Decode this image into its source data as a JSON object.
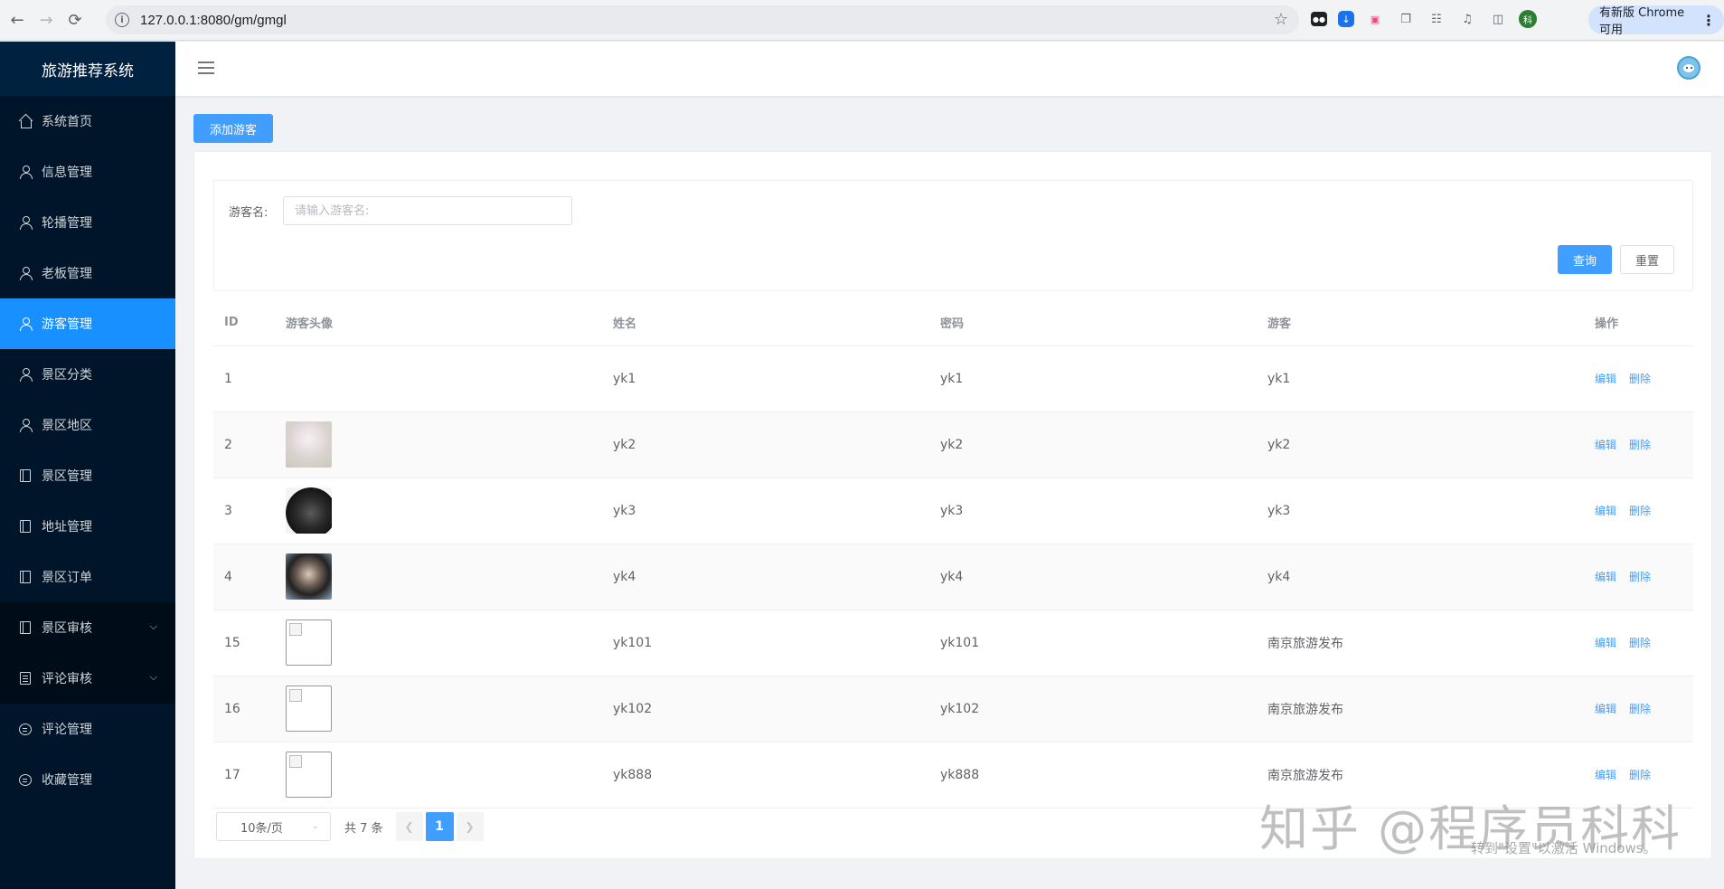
{
  "browser": {
    "url": "127.0.0.1:8080/gm/gmgl",
    "update_badge": "有新版 Chrome 可用",
    "profile_initial": "科"
  },
  "app": {
    "brand": "旅游推荐系统"
  },
  "sidebar": {
    "items": [
      {
        "label": "系统首页",
        "icon": "house-icon"
      },
      {
        "label": "信息管理",
        "icon": "user-icon"
      },
      {
        "label": "轮播管理",
        "icon": "user-icon"
      },
      {
        "label": "老板管理",
        "icon": "user-icon"
      },
      {
        "label": "游客管理",
        "icon": "user-icon",
        "active": true
      },
      {
        "label": "景区分类",
        "icon": "user-icon"
      },
      {
        "label": "景区地区",
        "icon": "user-icon"
      },
      {
        "label": "景区管理",
        "icon": "book-icon"
      },
      {
        "label": "地址管理",
        "icon": "book-icon"
      },
      {
        "label": "景区订单",
        "icon": "book-icon"
      },
      {
        "label": "景区审核",
        "icon": "book-icon",
        "submenu": true
      },
      {
        "label": "评论审核",
        "icon": "doc-icon",
        "submenu": true
      },
      {
        "label": "评论管理",
        "icon": "chat-icon"
      },
      {
        "label": "收藏管理",
        "icon": "chat-icon"
      }
    ]
  },
  "toolbar": {
    "add_label": "添加游客"
  },
  "search": {
    "label": "游客名:",
    "placeholder": "请输入游客名:",
    "query_label": "查询",
    "reset_label": "重置"
  },
  "table": {
    "headers": [
      "ID",
      "游客头像",
      "姓名",
      "密码",
      "游客",
      "操作"
    ],
    "edit_label": "编辑",
    "delete_label": "删除",
    "rows": [
      {
        "id": "1",
        "avatar": "none",
        "name": "yk1",
        "password": "yk1",
        "visitor": "yk1"
      },
      {
        "id": "2",
        "avatar": "a2",
        "name": "yk2",
        "password": "yk2",
        "visitor": "yk2"
      },
      {
        "id": "3",
        "avatar": "a3",
        "name": "yk3",
        "password": "yk3",
        "visitor": "yk3"
      },
      {
        "id": "4",
        "avatar": "a4",
        "name": "yk4",
        "password": "yk4",
        "visitor": "yk4"
      },
      {
        "id": "15",
        "avatar": "broken",
        "name": "yk101",
        "password": "yk101",
        "visitor": "南京旅游发布"
      },
      {
        "id": "16",
        "avatar": "broken",
        "name": "yk102",
        "password": "yk102",
        "visitor": "南京旅游发布"
      },
      {
        "id": "17",
        "avatar": "broken",
        "name": "yk888",
        "password": "yk888",
        "visitor": "南京旅游发布"
      }
    ]
  },
  "pagination": {
    "page_size": "10条/页",
    "total": "共 7 条",
    "current_page": "1"
  },
  "overlay": {
    "watermark": "知乎 @程序员科科",
    "activate_windows": "转到\"设置\"以激活 Windows。"
  },
  "colors": {
    "sidebar_bg": "#001529",
    "active_item": "#1890ff",
    "primary": "#409eff"
  }
}
